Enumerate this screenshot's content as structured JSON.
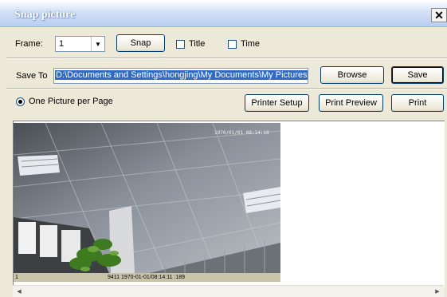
{
  "window": {
    "title": "Snap picture",
    "close_glyph": "✕"
  },
  "frame": {
    "label": "Frame:",
    "selected": "1"
  },
  "snap_button": "Snap",
  "options": {
    "title_label": "Title",
    "time_label": "Time"
  },
  "save": {
    "label": "Save To",
    "path": "D:\\Documents and Settings\\hongjing\\My Documents\\My Pictures",
    "browse_label": "Browse",
    "save_label": "Save"
  },
  "print": {
    "mode_label": "One Picture per Page",
    "printer_setup_label": "Printer Setup",
    "print_preview_label": "Print Preview",
    "print_label": "Print"
  },
  "preview": {
    "timestamp_top": "1970/01/01 08:14:18",
    "footer_left": "1",
    "footer_info": "9411  1970-01-01/08:14:11 :189"
  }
}
